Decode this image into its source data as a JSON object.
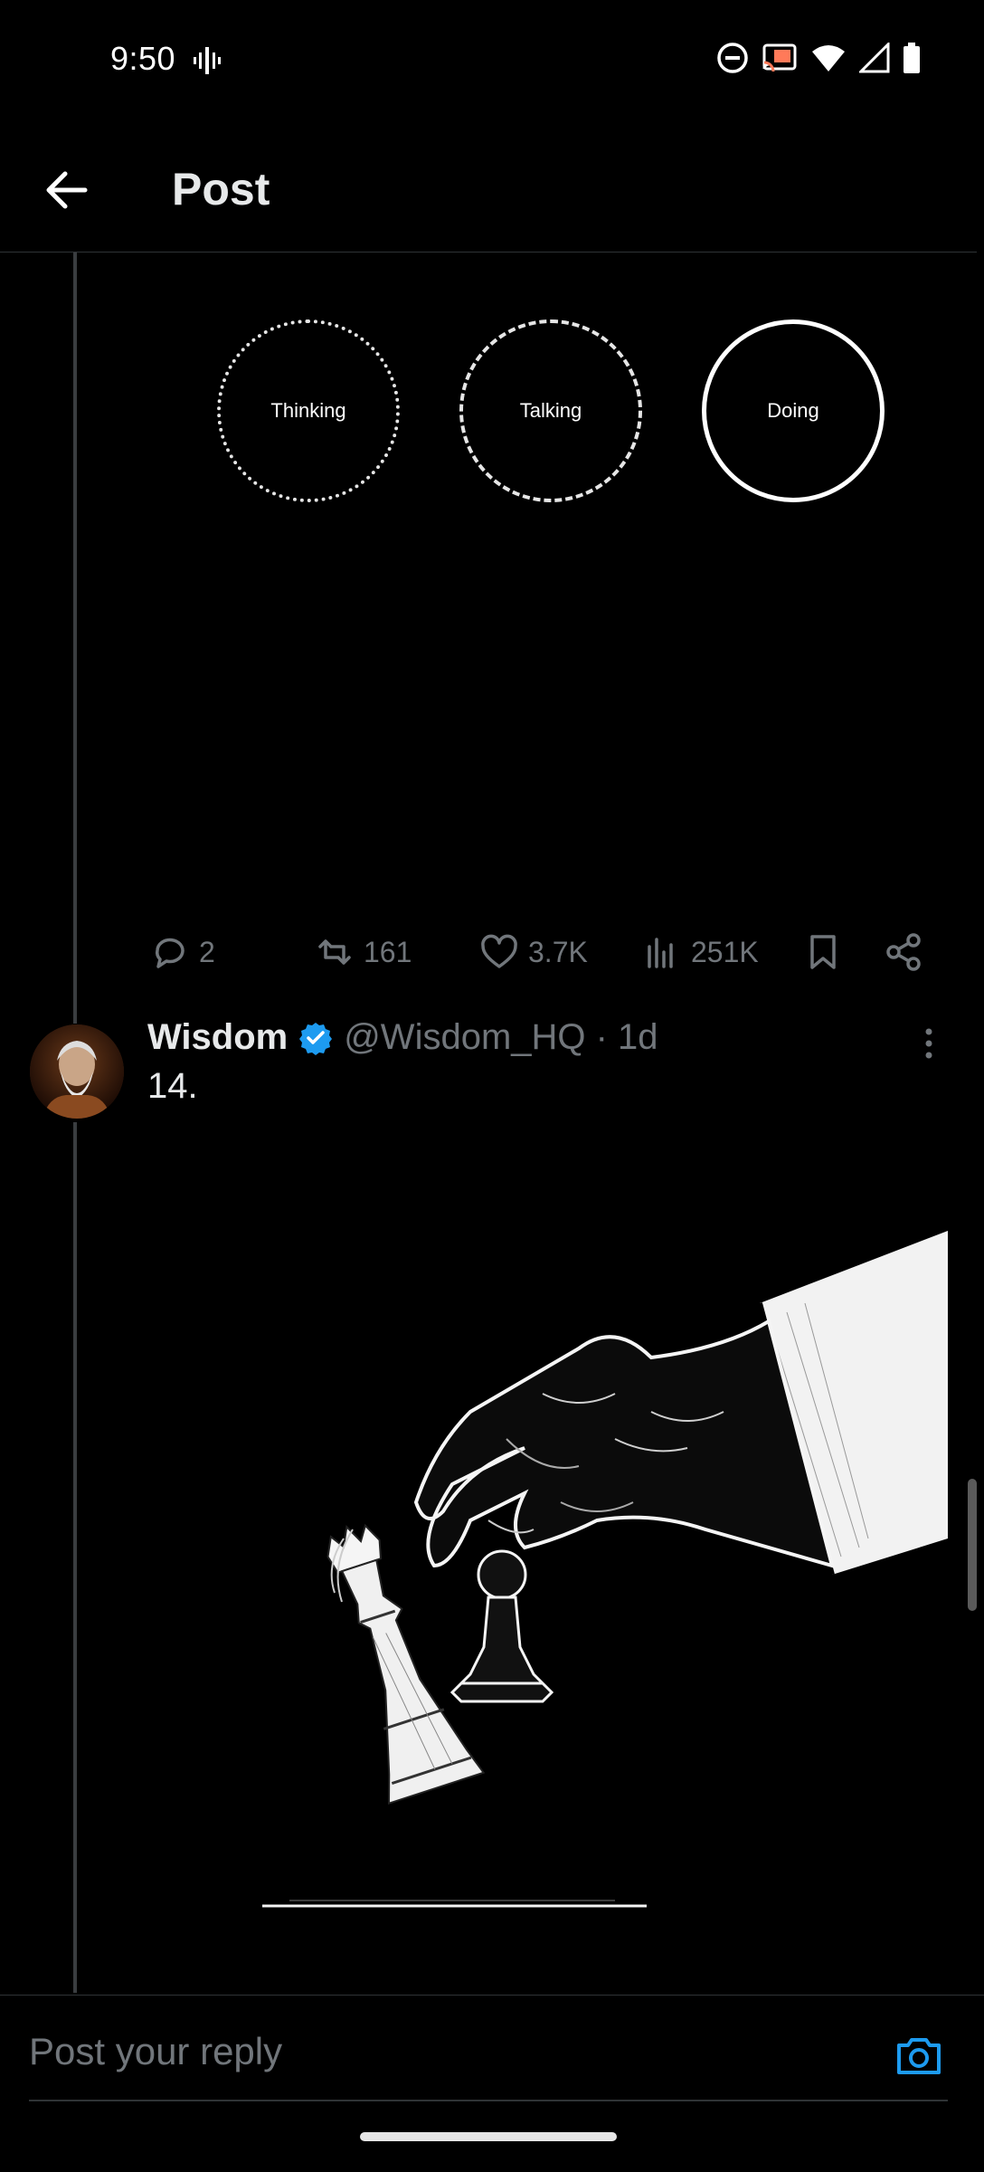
{
  "status_bar": {
    "time": "9:50"
  },
  "header": {
    "title": "Post"
  },
  "first_post": {
    "media_labels": [
      "Thinking",
      "Talking",
      "Doing"
    ]
  },
  "actions": {
    "replies": "2",
    "reposts": "161",
    "likes": "3.7K",
    "views": "251K"
  },
  "second_post": {
    "author_name": "Wisdom",
    "handle_time": "@Wisdom_HQ · 1d",
    "text": "14."
  },
  "reply": {
    "placeholder": "Post your reply"
  },
  "colors": {
    "background": "#000000",
    "text_primary": "#e7e9ea",
    "text_secondary": "#71767b",
    "accent": "#1d9bf0"
  }
}
